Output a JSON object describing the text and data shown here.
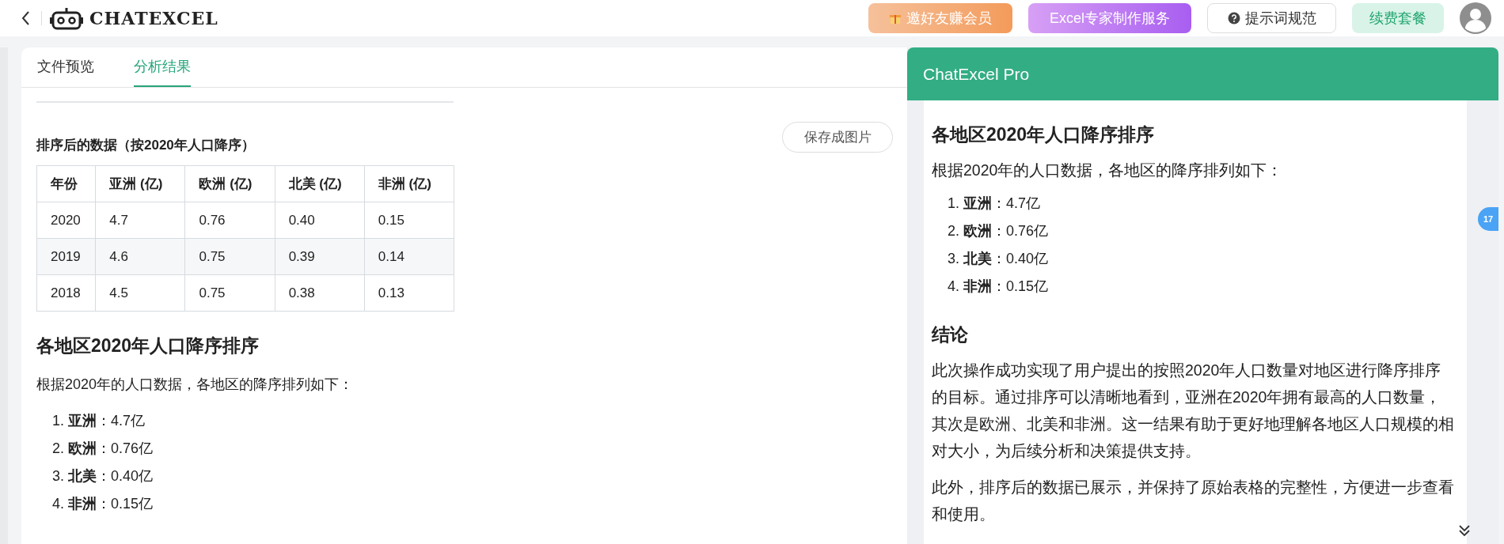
{
  "header": {
    "logo_text": "CHATEXCEL",
    "buttons": [
      {
        "label": "邀好友赚会员",
        "kind": "gift"
      },
      {
        "label": "Excel专家制作服务",
        "kind": "purple"
      },
      {
        "label": "提示词规范",
        "kind": "help"
      },
      {
        "label": "续费套餐",
        "kind": "mint"
      }
    ]
  },
  "tabs": [
    {
      "label": "文件预览",
      "selected": false
    },
    {
      "label": "分析结果",
      "selected": true
    }
  ],
  "result": {
    "section_title": "排序后的数据（按2020年人口降序）",
    "save_button": "保存成图片",
    "table": {
      "columns": [
        "年份",
        "亚洲 (亿)",
        "欧洲 (亿)",
        "北美 (亿)",
        "非洲 (亿)"
      ],
      "rows": [
        [
          "2020",
          "4.7",
          "0.76",
          "0.40",
          "0.15"
        ],
        [
          "2019",
          "4.6",
          "0.75",
          "0.39",
          "0.14"
        ],
        [
          "2018",
          "4.5",
          "0.75",
          "0.38",
          "0.13"
        ]
      ]
    },
    "heading": "各地区2020年人口降序排序",
    "paragraph": "根据2020年的人口数据，各地区的降序排列如下：",
    "list": [
      "1. **亚洲**：4.7亿",
      "2. **欧洲**：0.76亿",
      "3. **北美**：0.40亿",
      "4. **非洲**：0.15亿"
    ]
  },
  "pro_panel": {
    "title": "ChatExcel Pro",
    "blocks": [
      {
        "kind": "heading",
        "text": "各地区2020年人口降序排序"
      },
      {
        "kind": "paragraph",
        "text": "根据2020年的人口数据，各地区的降序排列如下："
      },
      {
        "kind": "list",
        "items": [
          "1. **亚洲**：4.7亿",
          "2. **欧洲**：0.76亿",
          "3. **北美**：0.40亿",
          "4. **非洲**：0.15亿"
        ]
      },
      {
        "kind": "heading",
        "text": "结论"
      },
      {
        "kind": "paragraph",
        "text": "此次操作成功实现了用户提出的按照2020年人口数量对地区进行降序排序的目标。通过排序可以清晰地看到，亚洲在2020年拥有最高的人口数量，其次是欧洲、北美和非洲。这一结果有助于更好地理解各地区人口规模的相对大小，为后续分析和决策提供支持。"
      },
      {
        "kind": "paragraph",
        "text": "此外，排序后的数据已展示，并保持了原始表格的完整性，方便进一步查看和使用。"
      }
    ],
    "badge": "17"
  }
}
